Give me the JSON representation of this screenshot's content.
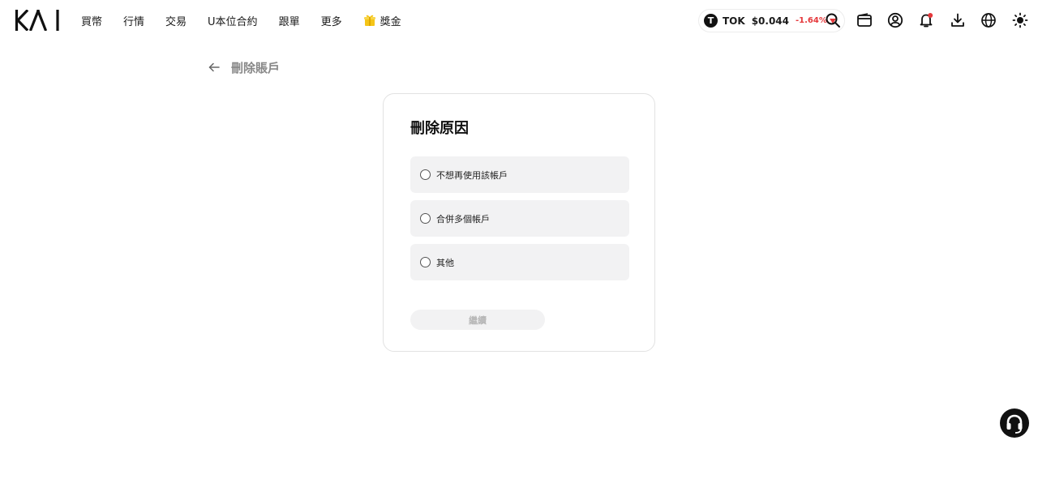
{
  "brand": {
    "logo_text": "KAI"
  },
  "nav": {
    "items": [
      {
        "label": "買幣"
      },
      {
        "label": "行情"
      },
      {
        "label": "交易"
      },
      {
        "label": "U本位合約"
      },
      {
        "label": "跟單"
      },
      {
        "label": "更多"
      },
      {
        "label": "獎金"
      }
    ]
  },
  "ticker": {
    "coin_glyph": "T",
    "symbol": "TOK",
    "price": "$0.044",
    "change": "-1.64%",
    "change_color": "#e5383b"
  },
  "header_icons": [
    "search-icon",
    "wallet-icon",
    "account-icon",
    "notification-bell-icon",
    "download-icon",
    "globe-icon",
    "theme-sun-icon"
  ],
  "page": {
    "title": "刪除賬戶"
  },
  "card": {
    "title": "刪除原因",
    "options": [
      {
        "label": "不想再使用該帳戶",
        "selected": false
      },
      {
        "label": "合併多個帳戶",
        "selected": false
      },
      {
        "label": "其他",
        "selected": false
      }
    ],
    "continue_label": "繼續",
    "continue_enabled": false
  },
  "colors": {
    "accent_negative": "#e5383b",
    "option_bg": "#f2f2f3",
    "disabled_text": "#b8b8b8"
  }
}
